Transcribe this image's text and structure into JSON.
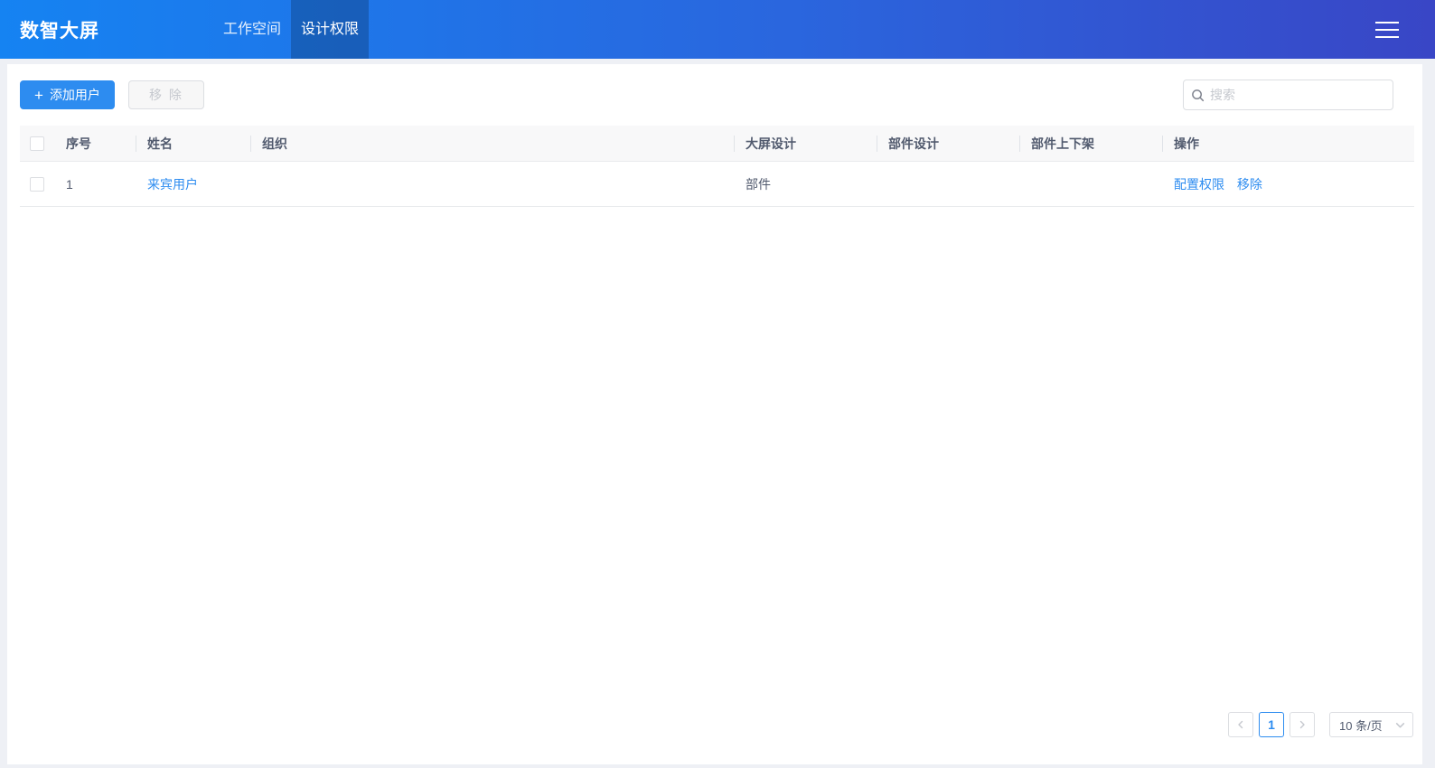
{
  "header": {
    "title": "数智大屏",
    "tabs": [
      {
        "label": "工作空间",
        "active": false
      },
      {
        "label": "设计权限",
        "active": true
      }
    ]
  },
  "toolbar": {
    "add_user_icon": "+",
    "add_user_label": "添加用户",
    "remove_label": "移 除",
    "search_placeholder": "搜索"
  },
  "table": {
    "columns": [
      "序号",
      "姓名",
      "组织",
      "大屏设计",
      "部件设计",
      "部件上下架",
      "操作"
    ],
    "rows": [
      {
        "index": "1",
        "name": "来宾用户",
        "org": "",
        "screen_design": "部件",
        "component_design": "",
        "component_shelf": "",
        "actions": [
          "配置权限",
          "移除"
        ]
      }
    ]
  },
  "pagination": {
    "prev_icon": "‹",
    "next_icon": "›",
    "current_page": "1",
    "page_size_label": "10 条/页"
  },
  "colors": {
    "accent": "#2d8cf0",
    "header_gradient_start": "#1583f2",
    "header_gradient_end": "#3946c6",
    "table_header_bg": "#f8f8f9",
    "border": "#dcdee2",
    "text": "#515a6e",
    "placeholder": "#c5c8ce",
    "page_bg": "#eef0f5"
  }
}
